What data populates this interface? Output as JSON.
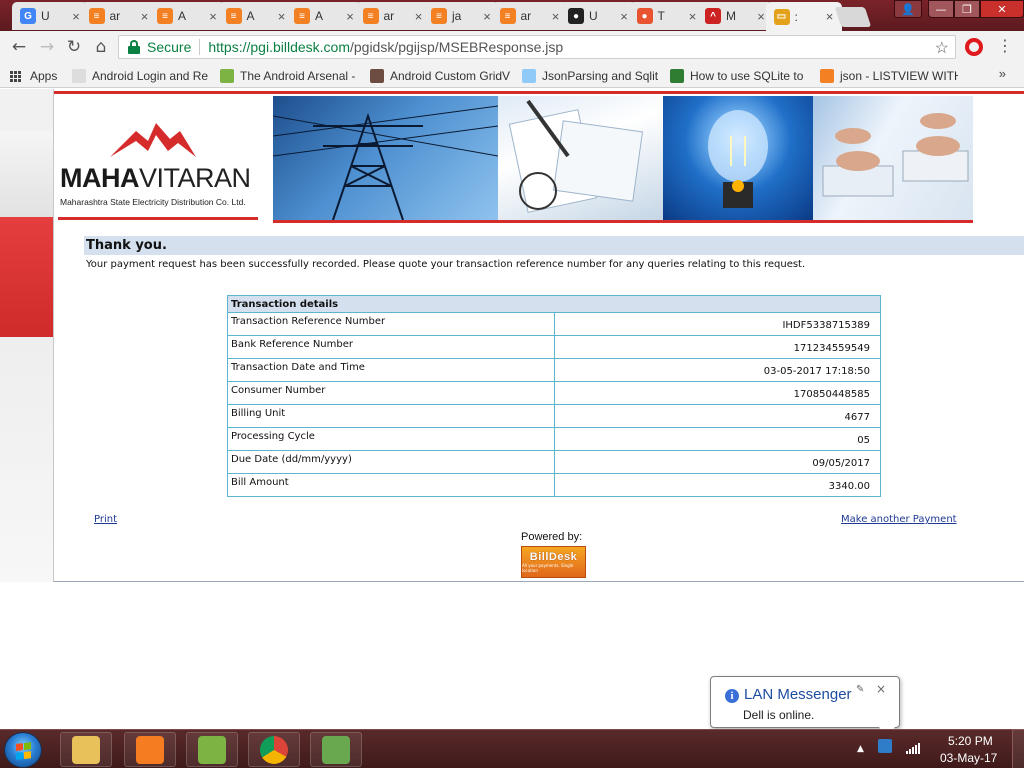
{
  "browser": {
    "tabs": [
      {
        "icon": "google-icon",
        "title": "U",
        "color": "#4285f4",
        "glyph": "G"
      },
      {
        "icon": "stackoverflow-icon",
        "title": "ar",
        "color": "#f48024",
        "glyph": "≡"
      },
      {
        "icon": "stackoverflow-icon",
        "title": "A",
        "color": "#f48024",
        "glyph": "≡"
      },
      {
        "icon": "stackoverflow-icon",
        "title": "A",
        "color": "#f48024",
        "glyph": "≡"
      },
      {
        "icon": "stackoverflow-icon",
        "title": "A",
        "color": "#f48024",
        "glyph": "≡"
      },
      {
        "icon": "stackoverflow-icon",
        "title": "ar",
        "color": "#f48024",
        "glyph": "≡"
      },
      {
        "icon": "stackoverflow-icon",
        "title": "ja",
        "color": "#f48024",
        "glyph": "≡"
      },
      {
        "icon": "stackoverflow-icon",
        "title": "ar",
        "color": "#f48024",
        "glyph": "≡"
      },
      {
        "icon": "github-icon",
        "title": "U",
        "color": "#222222",
        "glyph": "●"
      },
      {
        "icon": "tableau-icon",
        "title": "T",
        "color": "#e8542f",
        "glyph": "●"
      },
      {
        "icon": "mahavitaran-icon",
        "title": "M",
        "color": "#cc2222",
        "glyph": "^"
      },
      {
        "icon": "billdesk-icon",
        "title": ":",
        "color": "#e3a21b",
        "glyph": "▭"
      }
    ],
    "close_glyph": "×",
    "new_tab_label": "",
    "window_buttons": {
      "profile": "👤",
      "minimize": "—",
      "restore": "❐",
      "close": "✕"
    }
  },
  "toolbar": {
    "back": "←",
    "forward": "→",
    "reload": "↻",
    "home": "⌂",
    "secure_label": "Secure",
    "url_host": "https://pgi.billdesk.com",
    "url_path": "/pgidsk/pgijsp/MSEBResponse.jsp",
    "star": "☆",
    "menu": "⋮"
  },
  "bookmarks": {
    "apps_label": "Apps",
    "items": [
      {
        "label": "Android Login and Re",
        "icon": "page-icon",
        "color": "#dddddd"
      },
      {
        "label": "The Android Arsenal -",
        "icon": "android-icon",
        "color": "#7cb342"
      },
      {
        "label": "Android Custom GridV",
        "icon": "bug-icon",
        "color": "#6d4c41"
      },
      {
        "label": "JsonParsing and Sqlite",
        "icon": "puzzle-icon",
        "color": "#90caf9"
      },
      {
        "label": "How to use SQLite to",
        "icon": "android-head-icon",
        "color": "#2e7d32"
      },
      {
        "label": "json - LISTVIEW WITH",
        "icon": "stackoverflow-icon",
        "color": "#f48024"
      }
    ],
    "more": "»"
  },
  "header": {
    "logo_main": "MAHA",
    "logo_main2": "VITARAN",
    "logo_sub": "Maharashtra State Electricity Distribution Co. Ltd."
  },
  "message": {
    "title": "Thank you.",
    "body": "Your payment request has been successfully recorded. Please quote your transaction reference number for any queries relating to this request."
  },
  "transaction": {
    "heading": "Transaction details",
    "rows": [
      {
        "label": "Transaction Reference Number",
        "value": "IHDF5338715389"
      },
      {
        "label": "Bank Reference Number",
        "value": "171234559549"
      },
      {
        "label": "Transaction Date and Time",
        "value": "03-05-2017 17:18:50"
      },
      {
        "label": "Consumer Number",
        "value": "170850448585"
      },
      {
        "label": "Billing Unit",
        "value": "4677"
      },
      {
        "label": "Processing Cycle",
        "value": "05"
      },
      {
        "label": "Due Date (dd/mm/yyyy)",
        "value": "09/05/2017"
      },
      {
        "label": "Bill Amount",
        "value": "3340.00"
      }
    ]
  },
  "links": {
    "print": "Print",
    "make_another": "Make another Payment"
  },
  "footer": {
    "powered_by": "Powered by:",
    "billdesk_name": "BillDesk",
    "billdesk_tag": "All your payments. Single location"
  },
  "notification": {
    "title": "LAN Messenger",
    "message": "Dell is online.",
    "info_glyph": "i",
    "pin_glyph": "✎",
    "close_glyph": "×"
  },
  "taskbar": {
    "apps": [
      {
        "icon": "file-explorer-icon",
        "color": "#e8c15a"
      },
      {
        "icon": "xampp-icon",
        "color": "#f57c20"
      },
      {
        "icon": "notepadpp-icon",
        "color": "#7cb342"
      },
      {
        "icon": "chrome-icon",
        "color": "#4285f4"
      },
      {
        "icon": "android-studio-icon",
        "color": "#6aa84f"
      }
    ],
    "tray_arrow": "▲",
    "time": "5:20 PM",
    "date": "03-May-17"
  }
}
